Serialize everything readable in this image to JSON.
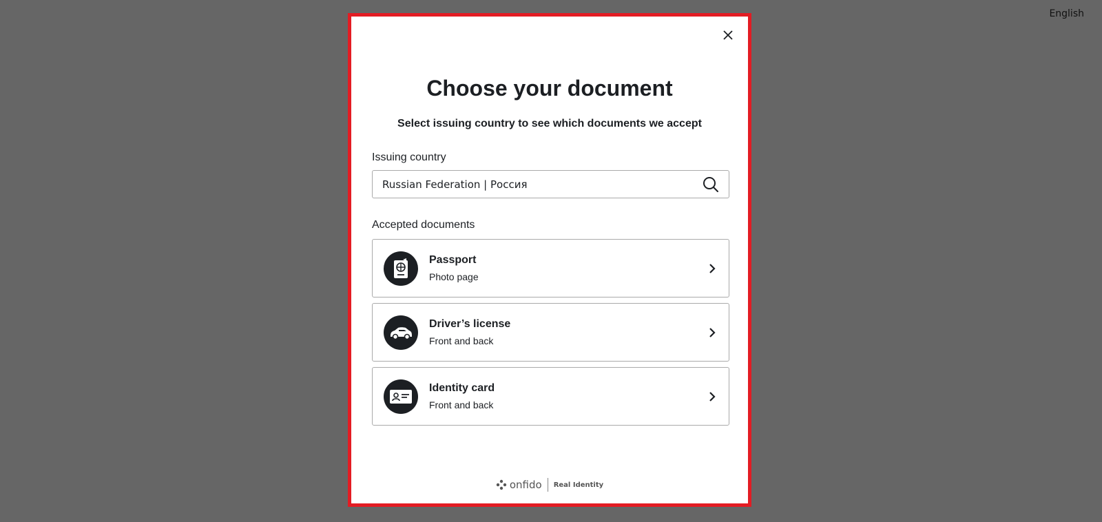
{
  "language": {
    "label": "English"
  },
  "modal": {
    "close_label": "×",
    "title": "Choose your document",
    "subtitle": "Select issuing country to see which documents we accept",
    "country_field": {
      "label": "Issuing country",
      "value": "Russian Federation | Россия",
      "icon": "search-icon"
    },
    "documents_label": "Accepted documents",
    "documents": [
      {
        "title": "Passport",
        "subtitle": "Photo page",
        "icon": "passport-icon"
      },
      {
        "title": "Driver’s license",
        "subtitle": "Front and back",
        "icon": "car-icon"
      },
      {
        "title": "Identity card",
        "subtitle": "Front and back",
        "icon": "id-card-icon"
      }
    ],
    "footer": {
      "brand": "onfido",
      "tagline": "Real Identity"
    }
  },
  "colors": {
    "backdrop": "#666666",
    "modal_border": "#e31c23",
    "text": "#1c1f23",
    "icon_circle": "#1c1f23"
  }
}
